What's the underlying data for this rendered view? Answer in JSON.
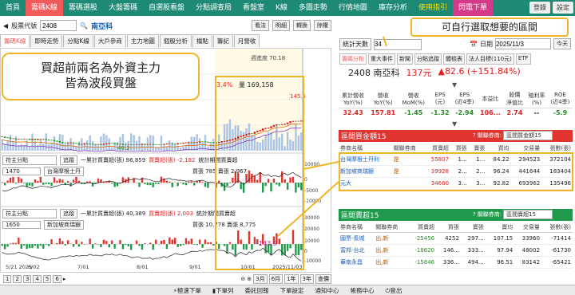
{
  "nav": {
    "items": [
      "首頁",
      "籌碼K線",
      "籌碼選股",
      "大盤籌碼",
      "自選股看盤",
      "分點調查局",
      "看盤室",
      "K線",
      "多圖走勢",
      "行情地圖",
      "庫存分析",
      "使用指引",
      "閃電下單"
    ],
    "active_index": 1,
    "right": [
      "登錄",
      "設定"
    ]
  },
  "stock_bar": {
    "label": "股票代號",
    "code": "2408",
    "name": "南亞科",
    "buttons": [
      "看法",
      "明細",
      "轉換",
      "除權"
    ]
  },
  "tabs": [
    "籌碼K線",
    "即時走勢",
    "分點K線",
    "大戶參商",
    "主力地圖",
    "個股分析",
    "檔點",
    "籌記",
    "月營收"
  ],
  "chart": {
    "volume_label": "量 169,158",
    "price_tag": "145.5",
    "change_pct": "3.4%",
    "ma_label": "週進度 70.18",
    "low_label": "40.2",
    "date_label": "03",
    "sub1": {
      "label": "符主分點",
      "code": "1470",
      "name": "台灣摩根士丹",
      "btn": "追蹤",
      "accum": "一累計買賣超(張) 86,859",
      "buysell": "買賣超(張) -2,182",
      "buysell2": "買張 785 賣張 2,967",
      "period": "統計期間買賣超"
    },
    "sub2": {
      "label": "符主分點",
      "code": "1650",
      "name": "新加坡商瑞銀",
      "btn": "追蹤",
      "accum": "一累計買賣超(張) 40,389",
      "buysell": "買賣超(張) 2,003",
      "buysell2": "買張 10,778 賣張 8,775",
      "period": "統計期間買賣超",
      "value_tag": "-143.9"
    },
    "axis_right": [
      "10000",
      "-",
      "0",
      "-5000",
      "-10000",
      "30000",
      "20000",
      "10000",
      "0",
      "-10000"
    ],
    "x_labels": [
      "5/21\n2025",
      "6/02",
      "7/01",
      "8/01",
      "9/01",
      "10/01",
      "2025/11/03"
    ]
  },
  "chart_footer": {
    "pages": [
      "1",
      "2",
      "3",
      "4",
      "5",
      "6"
    ],
    "ranges": [
      "3月",
      "6月",
      "1年",
      "3年"
    ],
    "more": "查價"
  },
  "callout_left": "買超前兩名為外資主力\n皆為波段買盤",
  "callout_right": "可自行選取想要的區間",
  "right_panel": {
    "stat_days_label": "統計天數",
    "stat_days": "34",
    "date_label": "日期",
    "date": "2025/11/3",
    "today": "今天",
    "tabs": [
      "籌碼分析",
      "重大事件",
      "新聞",
      "分點追蹤",
      "體檢表",
      "法人目標(110元)",
      "ETF"
    ],
    "quote": {
      "code_name": "2408 南亞科",
      "price": "137元",
      "change": "▲82.6 (+151.84%)"
    },
    "ratio_headers": [
      "累計營收\nYoY(%)",
      "營收\nYoY(%)",
      "營收\nMoM(%)",
      "EPS\n(元)",
      "EPS\n(近4季)",
      "本益比",
      "股價\n淨值比",
      "殖利率\n(%)",
      "ROE\n(近4季)"
    ],
    "ratio_values": [
      "32.43",
      "157.81",
      "-1.45",
      "-1.32",
      "-2.94",
      "106...",
      "2.74",
      "--",
      "-5.9"
    ],
    "buy_section": {
      "title": "區間買金額15",
      "type_label": "關聯券商:",
      "type_value": "區間買金額15",
      "headers": [
        "券商名稱",
        "關聯券商",
        "買賣超",
        "買張",
        "賣張",
        "買均",
        "交易量",
        "張數(張)"
      ],
      "rows": [
        [
          "台灣摩根士丹利",
          "是",
          "55807",
          "1...",
          "1...",
          "84.22",
          "294523",
          "372104"
        ],
        [
          "新加坡商瑞銀",
          "是",
          "39928",
          "2...",
          "2...",
          "96.24",
          "441644",
          "183404"
        ],
        [
          "元大",
          "",
          "34660",
          "3...",
          "3...",
          "92.82",
          "693962",
          "135496"
        ]
      ]
    },
    "sell_section": {
      "title": "區間賣超15",
      "type_label": "關聯券商:",
      "type_value": "區間賣超15",
      "headers": [
        "券商名稱",
        "關聯券商",
        "買賣超",
        "買張",
        "賣張",
        "賣均",
        "交易量",
        "張數(張)"
      ],
      "rows": [
        [
          "國票-長城",
          "出,新",
          "-25456",
          "4252",
          "297...",
          "107.15",
          "33960",
          "-71414"
        ],
        [
          "富邦-台北",
          "出,新",
          "-18620",
          "146...",
          "333...",
          "97.94",
          "48002",
          "-61730"
        ],
        [
          "華南永昌",
          "出,新",
          "-15846",
          "336...",
          "494...",
          "96.51",
          "83142",
          "-65421"
        ]
      ]
    }
  },
  "bottom_bar": [
    "極速下單",
    "下單列",
    "委託回報",
    "下單設定",
    "通知中心",
    "帳務中心",
    "登出"
  ],
  "colors": {
    "nav": "#1f8a74",
    "buy": "#e0342e",
    "sell": "#1e9a4a",
    "highlight": "#f0b429"
  }
}
